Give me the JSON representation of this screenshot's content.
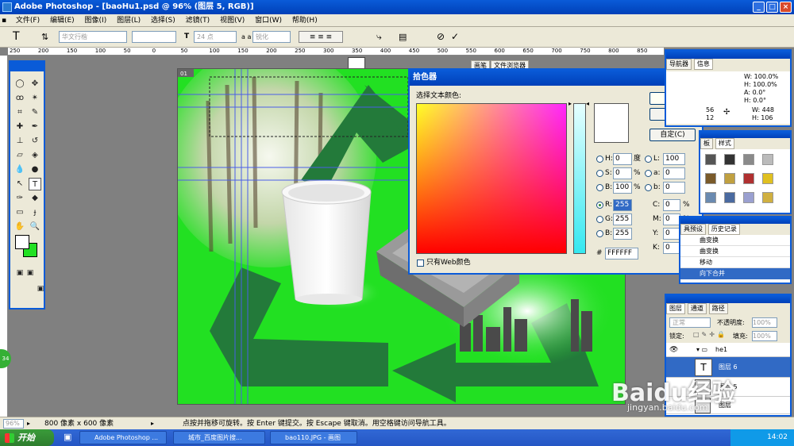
{
  "window": {
    "title": "Adobe Photoshop - [baoHu1.psd @ 96% (图层 5, RGB)]"
  },
  "menu": [
    "文件(F)",
    "编辑(E)",
    "图像(I)",
    "图层(L)",
    "选择(S)",
    "滤镜(T)",
    "视图(V)",
    "窗口(W)",
    "帮助(H)"
  ],
  "options": {
    "font_family": "华文行楷",
    "font_size": "24 点",
    "aa_label": "a a",
    "aa_mode": "锐化",
    "palette_tabs": [
      "画笔",
      "文件浏览器"
    ]
  },
  "ruler": {
    "ticks": [
      "250",
      "200",
      "150",
      "100",
      "50",
      "0",
      "50",
      "100",
      "150",
      "200",
      "250",
      "300",
      "350",
      "400",
      "450",
      "500",
      "550",
      "600",
      "650",
      "700",
      "750",
      "800",
      "850"
    ]
  },
  "document": {
    "tab": "01"
  },
  "picker": {
    "title": "拾色器",
    "prompt": "选择文本颜色:",
    "ok": "好",
    "cancel": "取消",
    "custom": "自定(C)",
    "web_only": "只有Web颜色",
    "hsb": {
      "h_label": "H:",
      "h": "0",
      "h_unit": "度",
      "s_label": "S:",
      "s": "0",
      "s_unit": "%",
      "b_label": "B:",
      "b": "100",
      "b_unit": "%"
    },
    "rgb": {
      "r_label": "R:",
      "r": "255",
      "g_label": "G:",
      "g": "255",
      "b_label": "B:",
      "b": "255"
    },
    "lab": {
      "l_label": "L:",
      "l": "100",
      "a_label": "a:",
      "a": "0",
      "b_label": "b:",
      "b": "0"
    },
    "cmyk": {
      "c_label": "C:",
      "c": "0",
      "m_label": "M:",
      "m": "0",
      "y_label": "Y:",
      "y": "0",
      "k_label": "K:",
      "k": "0",
      "unit": "%"
    },
    "hex_label": "#",
    "hex": "FFFFFF"
  },
  "info": {
    "tabs": [
      "导航器",
      "信息"
    ],
    "w_pct": "W: 100.0%",
    "h_pct": "H: 100.0%",
    "angle_a": "A: 0.0°",
    "angle_h": "H: 0.0°",
    "x": "56",
    "y": "12",
    "w_px": "W: 448",
    "h_px": "H: 106"
  },
  "styles": {
    "tabs": [
      "板",
      "样式"
    ]
  },
  "history": {
    "tabs": [
      "具预设",
      "历史记录"
    ],
    "items": [
      "曲变换",
      "曲变换",
      "移动",
      "向下合并"
    ]
  },
  "layers": {
    "tabs": [
      "图层",
      "通道",
      "路径"
    ],
    "blend": "正常",
    "opacity_label": "不透明度:",
    "opacity": "100%",
    "lock_label": "锁定:",
    "fill_label": "填充:",
    "fill": "100%",
    "rows": [
      {
        "name": "he1"
      },
      {
        "name": "图层 6"
      },
      {
        "name": "图层 5"
      },
      {
        "name": "图层"
      }
    ]
  },
  "status": {
    "zoom": "96%",
    "doc_size": "800 像素 x 600 像素",
    "hint": "点按并拖移可旋转。按 Enter 键提交。按 Escape 键取消。用空格键访问导航工具。"
  },
  "taskbar": {
    "start": "开始",
    "tasks": [
      "Adobe Photoshop ...",
      "城市_百度图片搜...",
      "bao110.JPG - 画图"
    ],
    "time": "14:02"
  },
  "watermark": {
    "brand": "Baidu经验",
    "url": "jingyan.baidu.com"
  },
  "colors": {
    "canvas_green": "#22e022",
    "xp_blue": "#0a5bd8",
    "dialog_bg": "#ece9d8"
  }
}
